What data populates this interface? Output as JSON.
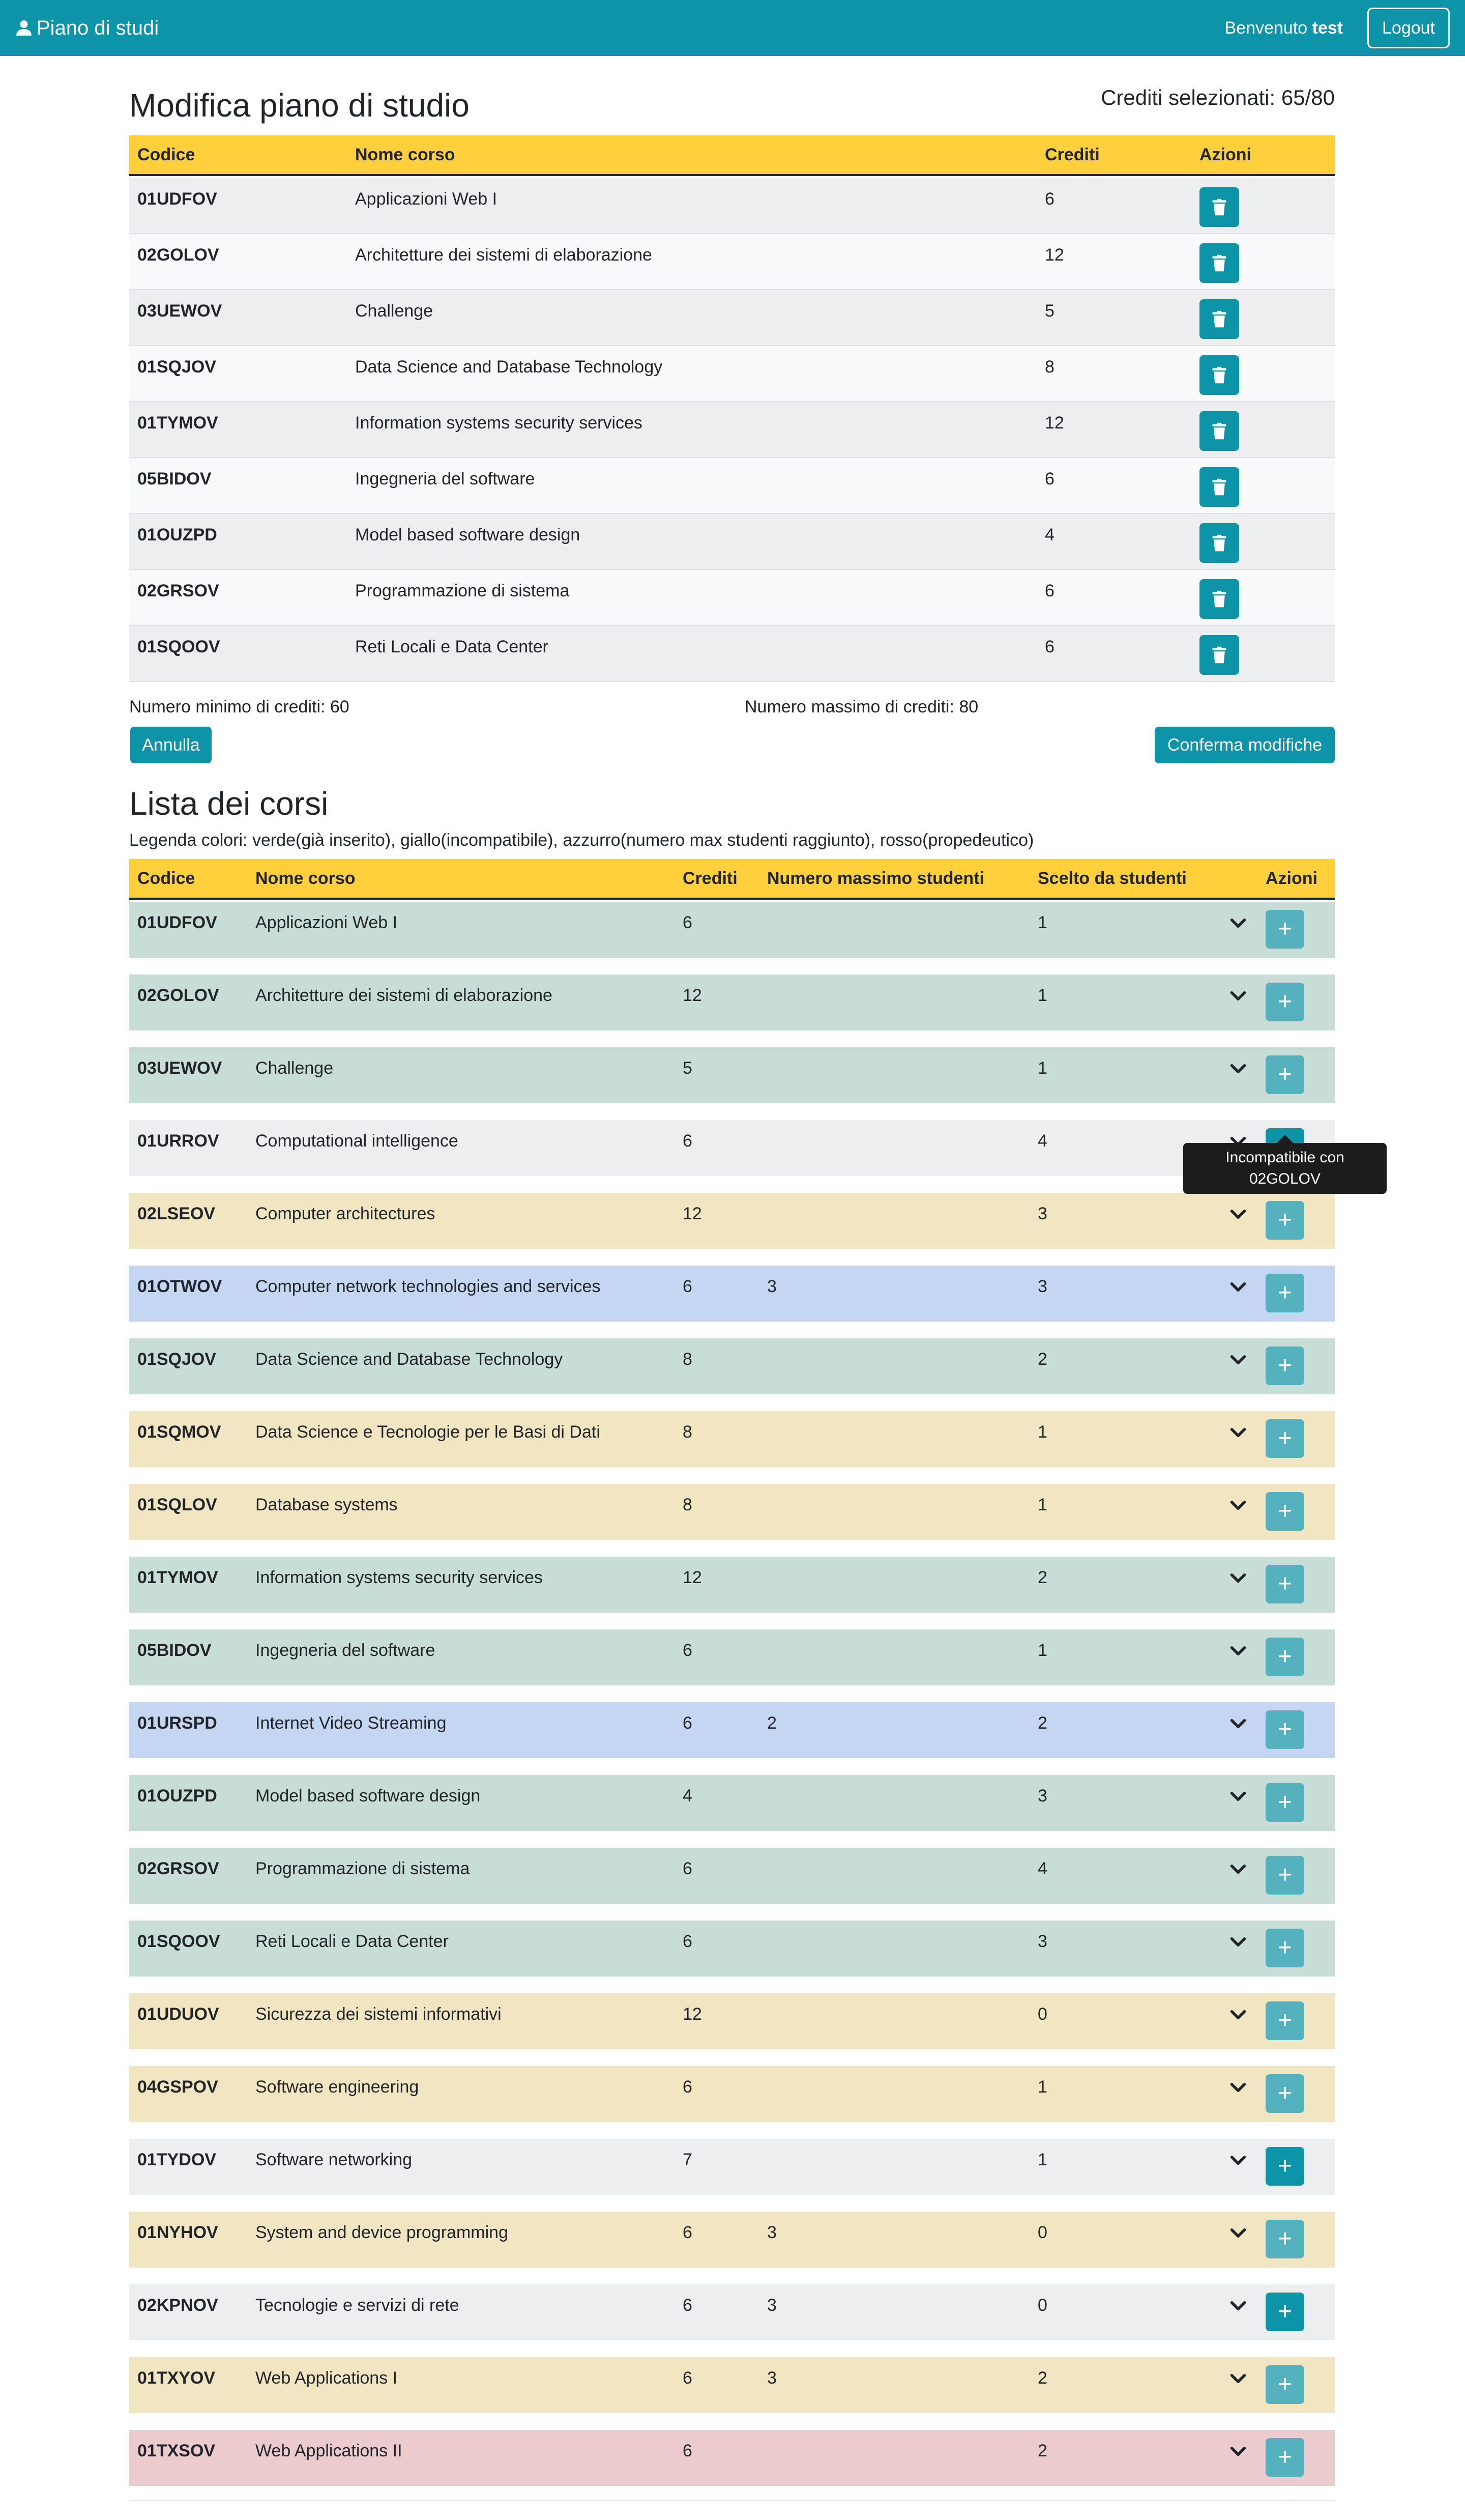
{
  "navbar": {
    "brand": "Piano di studi",
    "welcome_prefix": "Benvenuto",
    "username": "test",
    "logout": "Logout"
  },
  "edit": {
    "title": "Modifica piano di studio",
    "credits_selected": "Crediti selezionati: 65/80",
    "headers": {
      "code": "Codice",
      "name": "Nome corso",
      "credits": "Crediti",
      "actions": "Azioni"
    },
    "rows": [
      {
        "code": "01UDFOV",
        "name": "Applicazioni Web I",
        "credits": "6"
      },
      {
        "code": "02GOLOV",
        "name": "Architetture dei sistemi di elaborazione",
        "credits": "12"
      },
      {
        "code": "03UEWOV",
        "name": "Challenge",
        "credits": "5"
      },
      {
        "code": "01SQJOV",
        "name": "Data Science and Database Technology",
        "credits": "8"
      },
      {
        "code": "01TYMOV",
        "name": "Information systems security services",
        "credits": "12"
      },
      {
        "code": "05BIDOV",
        "name": "Ingegneria del software",
        "credits": "6"
      },
      {
        "code": "01OUZPD",
        "name": "Model based software design",
        "credits": "4"
      },
      {
        "code": "02GRSOV",
        "name": "Programmazione di sistema",
        "credits": "6"
      },
      {
        "code": "01SQOOV",
        "name": "Reti Locali e Data Center",
        "credits": "6"
      }
    ],
    "min_credits": "Numero minimo di crediti: 60",
    "max_credits": "Numero massimo di crediti: 80",
    "cancel": "Annulla",
    "confirm": "Conferma modifiche"
  },
  "list": {
    "title": "Lista dei corsi",
    "legend": "Legenda colori: verde(già inserito), giallo(incompatibile), azzurro(numero max studenti raggiunto), rosso(propedeutico)",
    "headers": {
      "code": "Codice",
      "name": "Nome corso",
      "credits": "Crediti",
      "max_students": "Numero massimo studenti",
      "chosen_by": "Scelto da studenti",
      "actions": "Azioni"
    },
    "rows": [
      {
        "code": "01UDFOV",
        "name": "Applicazioni Web I",
        "credits": "6",
        "max": "",
        "chosen": "1",
        "color": "green",
        "button": "dim"
      },
      {
        "code": "02GOLOV",
        "name": "Architetture dei sistemi di elaborazione",
        "credits": "12",
        "max": "",
        "chosen": "1",
        "color": "green",
        "button": "dim"
      },
      {
        "code": "03UEWOV",
        "name": "Challenge",
        "credits": "5",
        "max": "",
        "chosen": "1",
        "color": "green",
        "button": "dim"
      },
      {
        "code": "01URROV",
        "name": "Computational intelligence",
        "credits": "6",
        "max": "",
        "chosen": "4",
        "color": "grey",
        "button": "active"
      },
      {
        "code": "02LSEOV",
        "name": "Computer architectures",
        "credits": "12",
        "max": "",
        "chosen": "3",
        "color": "yellow",
        "button": "dim"
      },
      {
        "code": "01OTWOV",
        "name": "Computer network technologies and services",
        "credits": "6",
        "max": "3",
        "chosen": "3",
        "color": "blue",
        "button": "dim"
      },
      {
        "code": "01SQJOV",
        "name": "Data Science and Database Technology",
        "credits": "8",
        "max": "",
        "chosen": "2",
        "color": "green",
        "button": "dim"
      },
      {
        "code": "01SQMOV",
        "name": "Data Science e Tecnologie per le Basi di Dati",
        "credits": "8",
        "max": "",
        "chosen": "1",
        "color": "yellow",
        "button": "dim"
      },
      {
        "code": "01SQLOV",
        "name": "Database systems",
        "credits": "8",
        "max": "",
        "chosen": "1",
        "color": "yellow",
        "button": "dim"
      },
      {
        "code": "01TYMOV",
        "name": "Information systems security services",
        "credits": "12",
        "max": "",
        "chosen": "2",
        "color": "green",
        "button": "dim"
      },
      {
        "code": "05BIDOV",
        "name": "Ingegneria del software",
        "credits": "6",
        "max": "",
        "chosen": "1",
        "color": "green",
        "button": "dim"
      },
      {
        "code": "01URSPD",
        "name": "Internet Video Streaming",
        "credits": "6",
        "max": "2",
        "chosen": "2",
        "color": "blue",
        "button": "dim"
      },
      {
        "code": "01OUZPD",
        "name": "Model based software design",
        "credits": "4",
        "max": "",
        "chosen": "3",
        "color": "green",
        "button": "dim"
      },
      {
        "code": "02GRSOV",
        "name": "Programmazione di sistema",
        "credits": "6",
        "max": "",
        "chosen": "4",
        "color": "green",
        "button": "dim"
      },
      {
        "code": "01SQOOV",
        "name": "Reti Locali e Data Center",
        "credits": "6",
        "max": "",
        "chosen": "3",
        "color": "green",
        "button": "dim"
      },
      {
        "code": "01UDUOV",
        "name": "Sicurezza dei sistemi informativi",
        "credits": "12",
        "max": "",
        "chosen": "0",
        "color": "yellow",
        "button": "dim"
      },
      {
        "code": "04GSPOV",
        "name": "Software engineering",
        "credits": "6",
        "max": "",
        "chosen": "1",
        "color": "yellow",
        "button": "dim"
      },
      {
        "code": "01TYDOV",
        "name": "Software networking",
        "credits": "7",
        "max": "",
        "chosen": "1",
        "color": "grey",
        "button": "active"
      },
      {
        "code": "01NYHOV",
        "name": "System and device programming",
        "credits": "6",
        "max": "3",
        "chosen": "0",
        "color": "yellow",
        "button": "dim"
      },
      {
        "code": "02KPNOV",
        "name": "Tecnologie e servizi di rete",
        "credits": "6",
        "max": "3",
        "chosen": "0",
        "color": "grey",
        "button": "active"
      },
      {
        "code": "01TXYOV",
        "name": "Web Applications I",
        "credits": "6",
        "max": "3",
        "chosen": "2",
        "color": "yellow",
        "button": "dim"
      },
      {
        "code": "01TXSOV",
        "name": "Web Applications II",
        "credits": "6",
        "max": "",
        "chosen": "2",
        "color": "red",
        "button": "dim"
      }
    ],
    "tooltip": {
      "line1": "Incompatibile con",
      "line2": "02GOLOV"
    }
  }
}
